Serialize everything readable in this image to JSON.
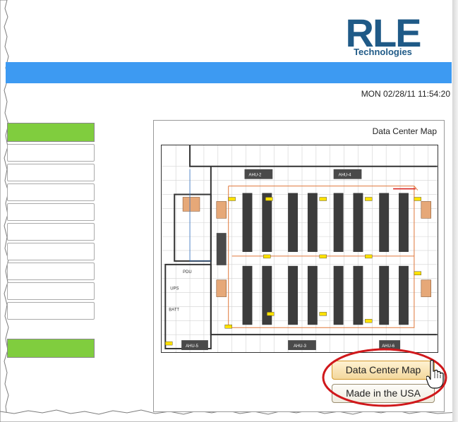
{
  "logo": {
    "name": "RLE",
    "subtitle": "Technologies"
  },
  "header": {
    "datetime": "MON 02/28/11 11:54:20"
  },
  "map_panel": {
    "title": "Data Center Map",
    "map_labels": {
      "ahu_2": "AHU-2",
      "ahu_3": "AHU-3",
      "ahu_4": "AHU-4",
      "ahu_5": "AHU-5",
      "ahu_6": "AHU-6",
      "ups": "UPS",
      "batt": "BATT",
      "pdu": "PDU"
    }
  },
  "buttons": {
    "data_center_map": "Data Center Map",
    "made_in_usa": "Made in the USA"
  },
  "colors": {
    "brand": "#1f5a87",
    "header_bar": "#3d9af2",
    "sidebar_active": "#80cd3e",
    "highlight_ring": "#d0181b",
    "button_active": "#f3d79c"
  },
  "icons": {
    "pointer": "hand-pointer-icon"
  }
}
